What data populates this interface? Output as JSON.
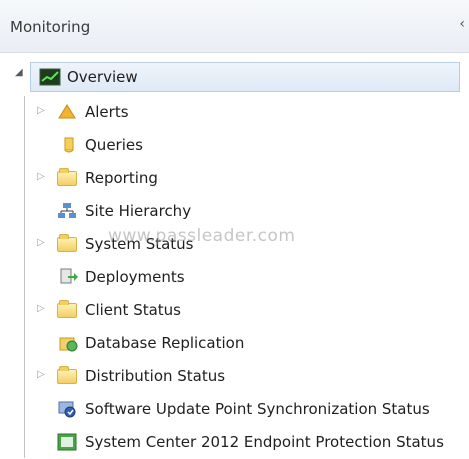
{
  "header": {
    "title": "Monitoring"
  },
  "tree": {
    "root": {
      "label": "Overview",
      "icon": "monitor-chart-icon"
    },
    "items": [
      {
        "label": "Alerts",
        "icon": "alert-folder-icon",
        "expandable": true
      },
      {
        "label": "Queries",
        "icon": "query-icon",
        "expandable": false
      },
      {
        "label": "Reporting",
        "icon": "folder-icon",
        "expandable": true
      },
      {
        "label": "Site Hierarchy",
        "icon": "site-hierarchy-icon",
        "expandable": false
      },
      {
        "label": "System Status",
        "icon": "folder-icon",
        "expandable": true
      },
      {
        "label": "Deployments",
        "icon": "deployments-icon",
        "expandable": false
      },
      {
        "label": "Client Status",
        "icon": "folder-icon",
        "expandable": true
      },
      {
        "label": "Database Replication",
        "icon": "database-replication-icon",
        "expandable": false
      },
      {
        "label": "Distribution Status",
        "icon": "folder-icon",
        "expandable": true
      },
      {
        "label": "Software Update Point Synchronization Status",
        "icon": "software-update-sync-icon",
        "expandable": false
      },
      {
        "label": "System Center 2012 Endpoint Protection Status",
        "icon": "endpoint-protection-icon",
        "expandable": false
      }
    ]
  },
  "watermark": "www.passleader.com",
  "colors": {
    "selection": "#dfe9f6",
    "folder": "#f2cf63",
    "header": "#eaeef4"
  }
}
